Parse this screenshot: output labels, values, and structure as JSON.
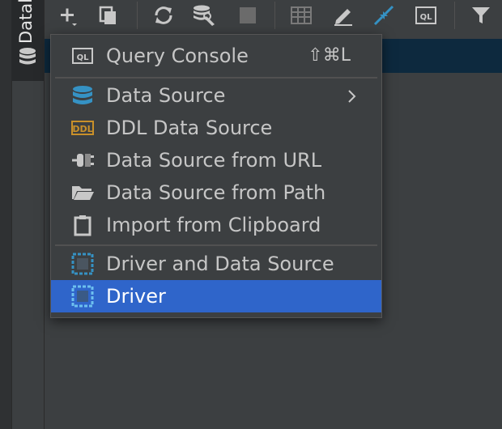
{
  "sidebar": {
    "tab_title": "Datal",
    "icon": "database-icon"
  },
  "toolbar": {
    "buttons": [
      {
        "name": "add-icon"
      },
      {
        "name": "copy-icon"
      },
      {
        "name": "refresh-icon"
      },
      {
        "name": "schema-settings-icon"
      },
      {
        "name": "stop-icon"
      },
      {
        "name": "table-icon"
      },
      {
        "name": "edit-icon"
      },
      {
        "name": "jump-to-icon"
      },
      {
        "name": "query-console-icon"
      },
      {
        "name": "filter-icon"
      }
    ],
    "ql_text": "QL"
  },
  "menu": {
    "query_console": {
      "label": "Query Console",
      "shortcut": "⇧⌘L",
      "icon": "query-console-icon",
      "icon_text": "QL"
    },
    "data_source": {
      "label": "Data Source",
      "icon": "database-icon"
    },
    "ddl_data_source": {
      "label": "DDL Data Source",
      "icon": "ddl-icon",
      "icon_text": "DDL"
    },
    "data_source_url": {
      "label": "Data Source from URL",
      "icon": "plug-icon"
    },
    "data_source_path": {
      "label": "Data Source from Path",
      "icon": "folder-icon"
    },
    "import_clipboard": {
      "label": "Import from Clipboard",
      "icon": "clipboard-icon"
    },
    "driver_and_data_source": {
      "label": "Driver and Data Source",
      "icon": "driver-icon"
    },
    "driver": {
      "label": "Driver",
      "icon": "driver-icon",
      "selected": true
    }
  },
  "colors": {
    "background": "#3c3f41",
    "selection": "#2f65ca",
    "accent_blue": "#3592c4",
    "ddl_orange": "#c9902a"
  }
}
